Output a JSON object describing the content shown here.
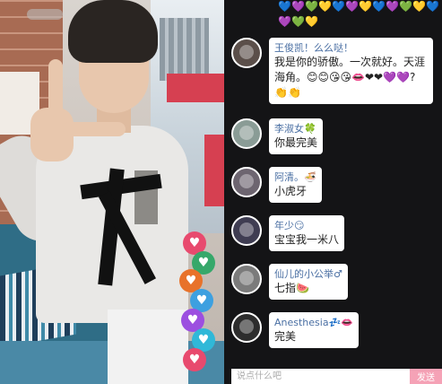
{
  "chat": {
    "top_emojis": [
      "💙",
      "💜",
      "💚",
      "💛",
      "💙",
      "💜",
      "💛",
      "💙",
      "💜",
      "💚",
      "💛",
      "💙",
      "💜",
      "💚",
      "💛"
    ],
    "messages": [
      {
        "user": "王俊凯！么么哒！",
        "text": "我是你的骄傲。一次就好。天涯海角。😊😊😘😘👄❤❤💜💜?👏👏",
        "avatar_color": "#5b4f4a"
      },
      {
        "user": "李淑女🍀",
        "text": "你最完美",
        "avatar_color": "#8a9c96"
      },
      {
        "user": "阿清。🍜",
        "text": "小虎牙",
        "avatar_color": "#6d6570"
      },
      {
        "user": "年少😏",
        "text": "宝宝我一米八",
        "avatar_color": "#3f3d52"
      },
      {
        "user": "仙儿的小公举♂",
        "text": "七指🍉",
        "avatar_color": "#7b7b7b"
      },
      {
        "user": "Anesthesia💤👄",
        "text": "完美",
        "avatar_color": "#2d2d2d"
      }
    ]
  },
  "input": {
    "placeholder": "说点什么吧",
    "send_label": "发送"
  },
  "video": {
    "hearts": [
      {
        "color": "#e84a6e",
        "glyph": "♥"
      },
      {
        "color": "#36a86a",
        "glyph": "♥"
      },
      {
        "color": "#e8722a",
        "glyph": "♥"
      },
      {
        "color": "#3da0e0",
        "glyph": "♥"
      },
      {
        "color": "#9c4fe0",
        "glyph": "♥"
      },
      {
        "color": "#30b8d8",
        "glyph": "♥"
      },
      {
        "color": "#e84a6e",
        "glyph": "♥"
      }
    ]
  }
}
